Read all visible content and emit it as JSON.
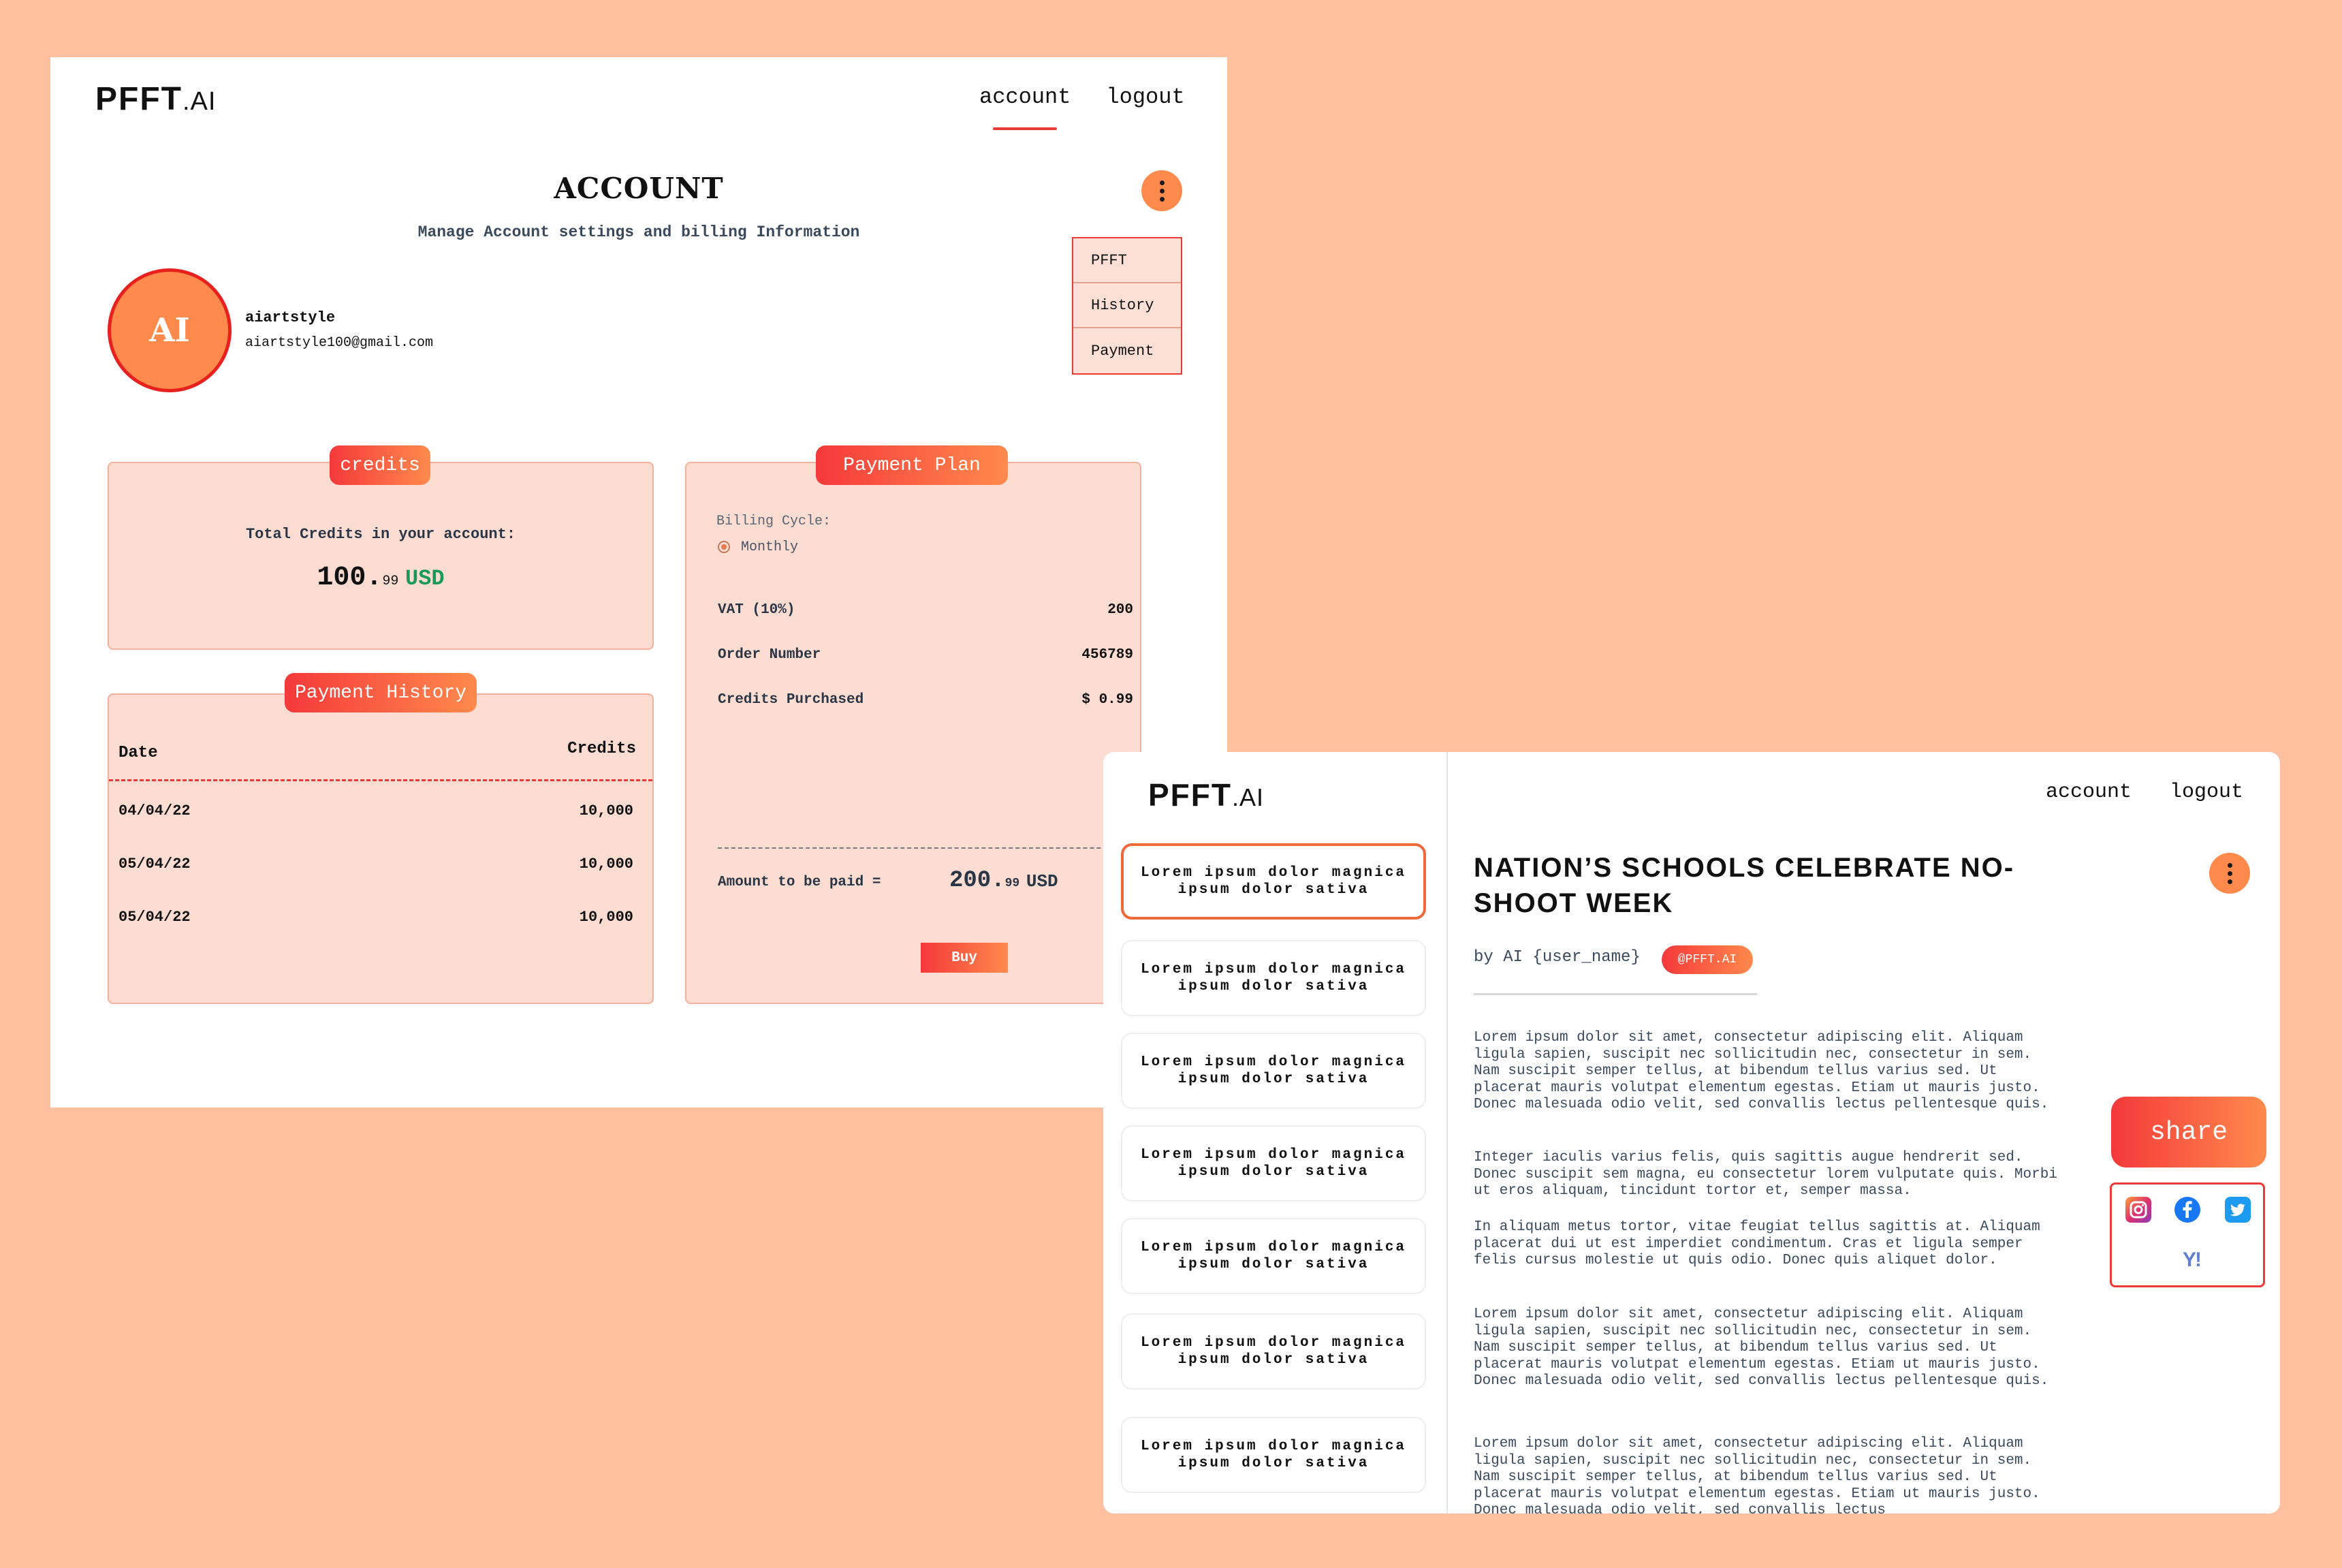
{
  "account_window": {
    "logo_main": "PFFT",
    "logo_suffix": ".AI",
    "nav": {
      "account": "account",
      "logout": "logout"
    },
    "title": "ACCOUNT",
    "subtitle": "Manage Account settings and billing Information",
    "menu": [
      "PFFT",
      "History",
      "Payment"
    ],
    "avatar_initials": "AI",
    "username": "aiartstyle",
    "email": "aiartstyle100@gmail.com",
    "credits": {
      "pill": "credits",
      "label": "Total Credits in your account:",
      "amount_main": "100.",
      "amount_cents": "99",
      "currency": "USD"
    },
    "payment_history": {
      "pill": "Payment History",
      "col_date": "Date",
      "col_credits": "Credits",
      "rows": [
        {
          "date": "04/04/22",
          "credits": "10,000"
        },
        {
          "date": "05/04/22",
          "credits": "10,000"
        },
        {
          "date": "05/04/22",
          "credits": "10,000"
        }
      ]
    },
    "payment_plan": {
      "pill": "Payment Plan",
      "billing_cycle_label": "Billing Cycle:",
      "billing_cycle_option": "Monthly",
      "rows": [
        {
          "label": "VAT (10%)",
          "value": "200"
        },
        {
          "label": "Order Number",
          "value": "456789"
        },
        {
          "label": "Credits Purchased",
          "value": "$ 0.99"
        }
      ],
      "amount_label": "Amount to be paid =",
      "amount_main": "200.",
      "amount_cents": "99",
      "currency": "USD",
      "buy_label": "Buy"
    }
  },
  "article_window": {
    "logo_main": "PFFT",
    "logo_suffix": ".AI",
    "nav": {
      "account": "account",
      "logout": "logout"
    },
    "list_items": [
      "Lorem ipsum dolor magnica ipsum dolor sativa",
      "Lorem ipsum dolor magnica ipsum dolor sativa",
      "Lorem ipsum dolor magnica ipsum dolor sativa",
      "Lorem ipsum dolor magnica ipsum dolor sativa",
      "Lorem ipsum dolor magnica ipsum dolor sativa",
      "Lorem ipsum dolor magnica ipsum dolor sativa",
      "Lorem ipsum dolor magnica ipsum dolor sativa"
    ],
    "title": "NATION’S SCHOOLS CELEBRATE NO-SHOOT WEEK",
    "byline": "by AI {user_name}",
    "tag": "@PFFT.AI",
    "paragraphs": [
      "Lorem ipsum dolor sit amet, consectetur adipiscing elit. Aliquam ligula sapien, suscipit nec sollicitudin nec, consectetur in sem. Nam suscipit semper tellus, at bibendum tellus varius sed. Ut placerat mauris volutpat elementum egestas. Etiam ut mauris justo. Donec malesuada odio velit, sed convallis lectus pellentesque quis.",
      "Integer iaculis varius felis, quis sagittis augue hendrerit sed. Donec suscipit sem magna, eu consectetur lorem vulputate quis. Morbi ut eros aliquam, tincidunt tortor et, semper massa.",
      "In aliquam metus tortor, vitae feugiat tellus sagittis at. Aliquam placerat dui ut est imperdiet condimentum. Cras et ligula semper felis cursus molestie ut quis odio. Donec quis aliquet dolor.",
      "Lorem ipsum dolor sit amet, consectetur adipiscing elit. Aliquam ligula sapien, suscipit nec sollicitudin nec, consectetur in sem. Nam suscipit semper tellus, at bibendum tellus varius sed. Ut placerat mauris volutpat elementum egestas. Etiam ut mauris justo. Donec malesuada odio velit, sed convallis lectus pellentesque quis.",
      "Lorem ipsum dolor sit amet, consectetur adipiscing elit. Aliquam ligula sapien, suscipit nec sollicitudin nec, consectetur in sem. Nam suscipit semper tellus, at bibendum tellus varius sed. Ut placerat mauris volutpat elementum egestas. Etiam ut mauris justo. Donec malesuada odio velit, sed convallis lectus"
    ],
    "share_label": "share",
    "social_icons": [
      "instagram-icon",
      "facebook-icon",
      "twitter-icon",
      "yahoo-icon"
    ],
    "yahoo_glyph": "Y!"
  },
  "colors": {
    "background": "#ffc0a0",
    "accent_red": "#e83a36",
    "accent_orange": "#ff8a4c",
    "card_bg": "#fddcd2",
    "usd_green": "#1a9a57"
  }
}
